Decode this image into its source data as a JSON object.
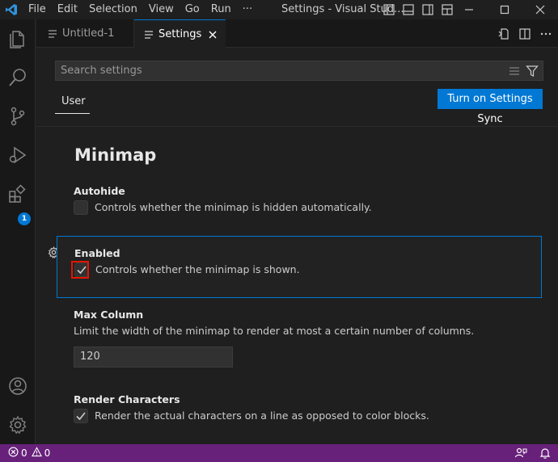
{
  "titlebar": {
    "menu": [
      "File",
      "Edit",
      "Selection",
      "View",
      "Go",
      "Run",
      "···"
    ],
    "window_title": "Settings - Visual Stud..."
  },
  "activity": {
    "icons": [
      "explorer-icon",
      "search-icon",
      "source-control-icon",
      "run-debug-icon",
      "extensions-icon",
      "account-icon",
      "manage-gear-icon"
    ],
    "extensions_badge": "1"
  },
  "tabs": [
    {
      "label": "Untitled-1",
      "active": false
    },
    {
      "label": "Settings",
      "active": true
    }
  ],
  "settings": {
    "search_placeholder": "Search settings",
    "scope_tab": "User",
    "sync_button": "Turn on Settings Sync",
    "section_title": "Minimap",
    "items": [
      {
        "title": "Autohide",
        "description": "Controls whether the minimap is hidden automatically.",
        "checked": false
      },
      {
        "title": "Enabled",
        "description": "Controls whether the minimap is shown.",
        "checked": true
      },
      {
        "title": "Max Column",
        "description": "Limit the width of the minimap to render at most a certain number of columns.",
        "value": "120"
      },
      {
        "title": "Render Characters",
        "description": "Render the actual characters on a line as opposed to color blocks.",
        "checked": true
      }
    ]
  },
  "statusbar": {
    "errors": "0",
    "warnings": "0"
  },
  "colors": {
    "accent": "#0078d4",
    "statusbar": "#68217a",
    "highlight": "#e51400"
  }
}
